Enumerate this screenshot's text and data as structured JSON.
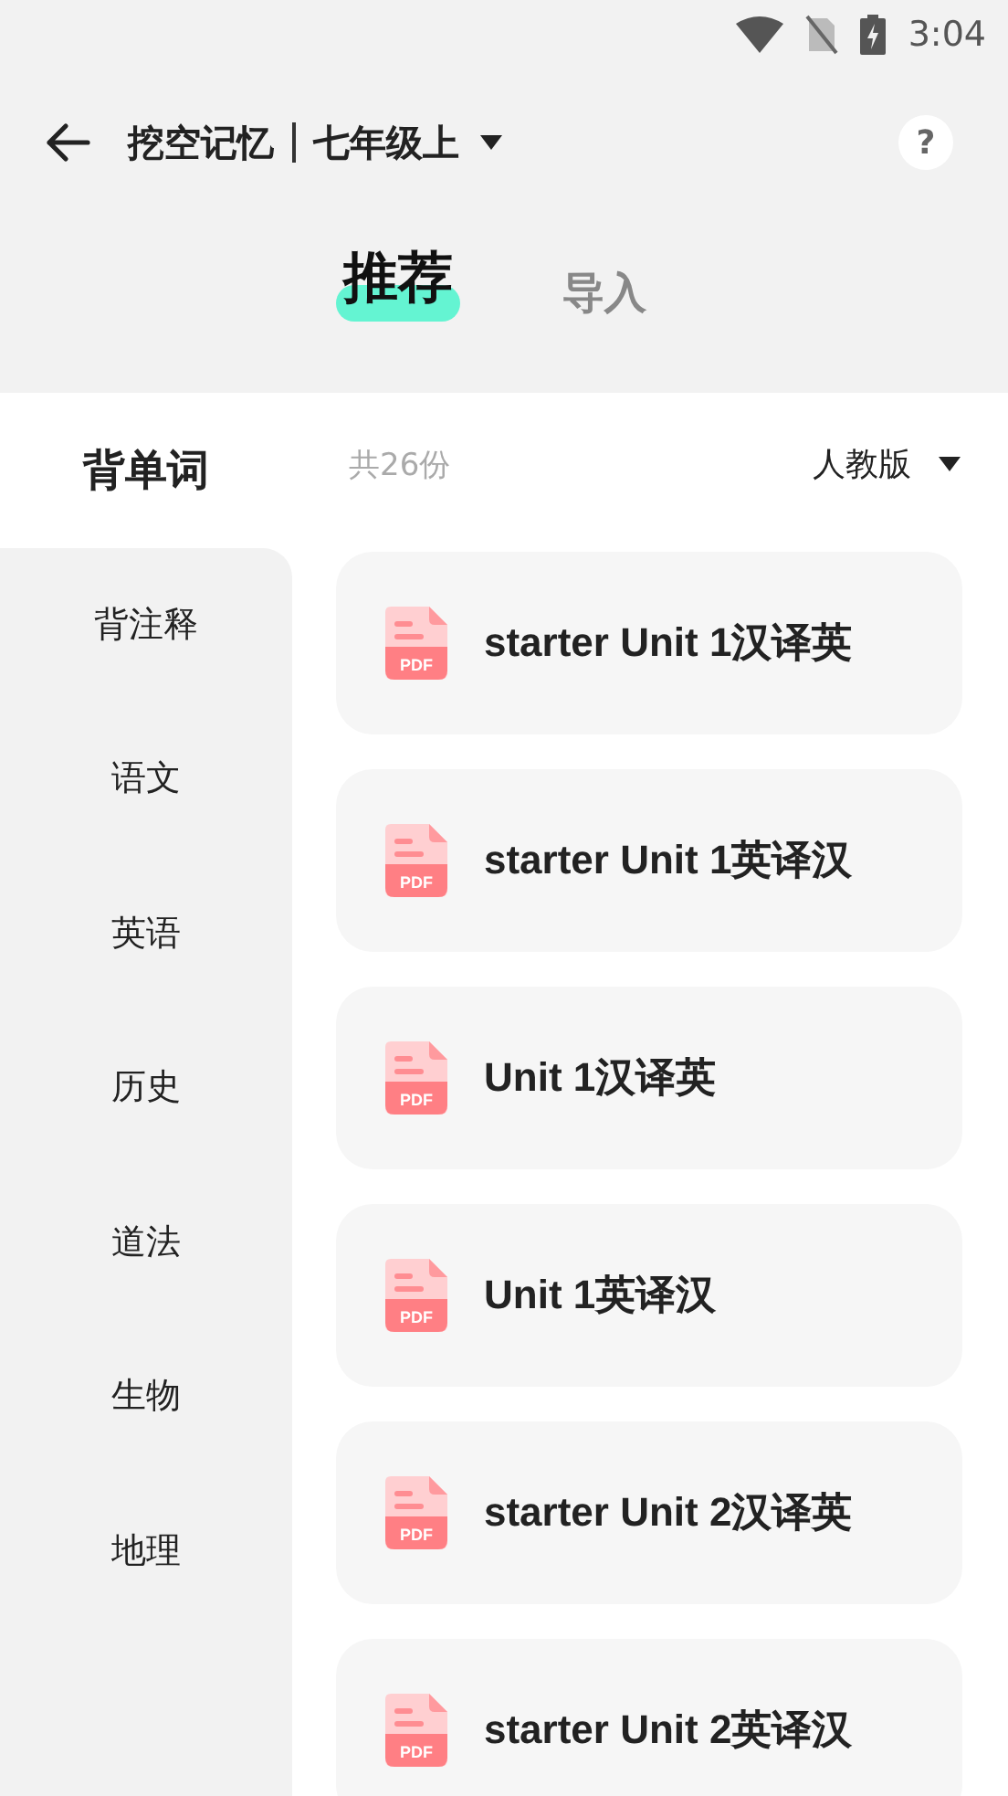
{
  "status_bar": {
    "time": "3:04"
  },
  "header": {
    "title": "挖空记忆",
    "grade": "七年级上",
    "help": "?"
  },
  "tabs": [
    {
      "label": "推荐",
      "selected": true
    },
    {
      "label": "导入",
      "selected": false
    }
  ],
  "sidebar": {
    "items": [
      {
        "label": "背单词",
        "selected": true
      },
      {
        "label": "背注释",
        "selected": false
      },
      {
        "label": "语文",
        "selected": false
      },
      {
        "label": "英语",
        "selected": false
      },
      {
        "label": "历史",
        "selected": false
      },
      {
        "label": "道法",
        "selected": false
      },
      {
        "label": "生物",
        "selected": false
      },
      {
        "label": "地理",
        "selected": false
      }
    ]
  },
  "list_header": {
    "count": "共26份",
    "edition": "人教版"
  },
  "files": [
    {
      "icon_label": "PDF",
      "title": "starter Unit 1汉译英"
    },
    {
      "icon_label": "PDF",
      "title": "starter Unit 1英译汉"
    },
    {
      "icon_label": "PDF",
      "title": "Unit 1汉译英"
    },
    {
      "icon_label": "PDF",
      "title": "Unit 1英译汉"
    },
    {
      "icon_label": "PDF",
      "title": "starter Unit 2汉译英"
    },
    {
      "icon_label": "PDF",
      "title": "starter Unit 2英译汉"
    }
  ]
}
